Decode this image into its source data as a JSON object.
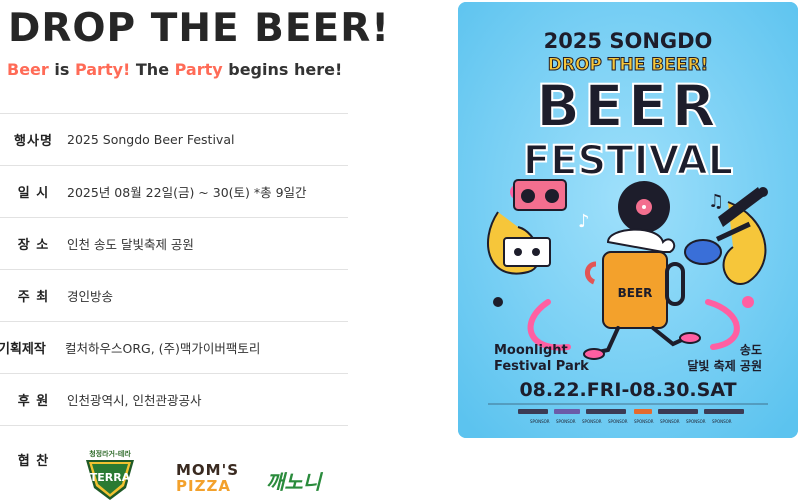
{
  "header": {
    "title": "DROP THE BEER!",
    "tagline": {
      "w1": "Beer",
      "w2": " is ",
      "w3": "Party!",
      "w4": " The ",
      "w5": "Party",
      "w6": " begins here!"
    }
  },
  "info": [
    {
      "label": "행사명",
      "value": "2025 Songdo Beer Festival"
    },
    {
      "label": "일 시",
      "value": "2025년 08월 22일(금) ~ 30(토) *총 9일간"
    },
    {
      "label": "장 소",
      "value": "인천 송도 달빛축제 공원"
    },
    {
      "label": "주 최",
      "value": "경인방송"
    },
    {
      "label": "기획제작",
      "value": "컬처하우스ORG, (주)맥가이버팩토리"
    },
    {
      "label": "후 원",
      "value": "인천광역시, 인천관광공사"
    },
    {
      "label": "협 찬",
      "value": ""
    }
  ],
  "sponsors": {
    "terra_top": "청정라거-테라",
    "terra": "TERRA",
    "moms_1": "MOM'S",
    "moms_2": "PIZZA",
    "ganoni": "깨노니"
  },
  "poster": {
    "year_line": "2025 SONGDO",
    "drop_line": "DROP THE BEER!",
    "beer": "BEER",
    "festival": "FESTIVAL",
    "cup_label": "BEER",
    "venue_en_1": "Moonlight",
    "venue_en_2": "Festival Park",
    "venue_kr_1": "송도",
    "venue_kr_2": "달빛 축제 공원",
    "dates": "08.22.FRI-08.30.SAT",
    "sponsor_word": "SPONSOR"
  },
  "colors": {
    "accent": "#ff6b57",
    "poster_bg": "#7dd3f5",
    "poster_yellow": "#f6c63a",
    "poster_dark": "#1d1d2b"
  }
}
